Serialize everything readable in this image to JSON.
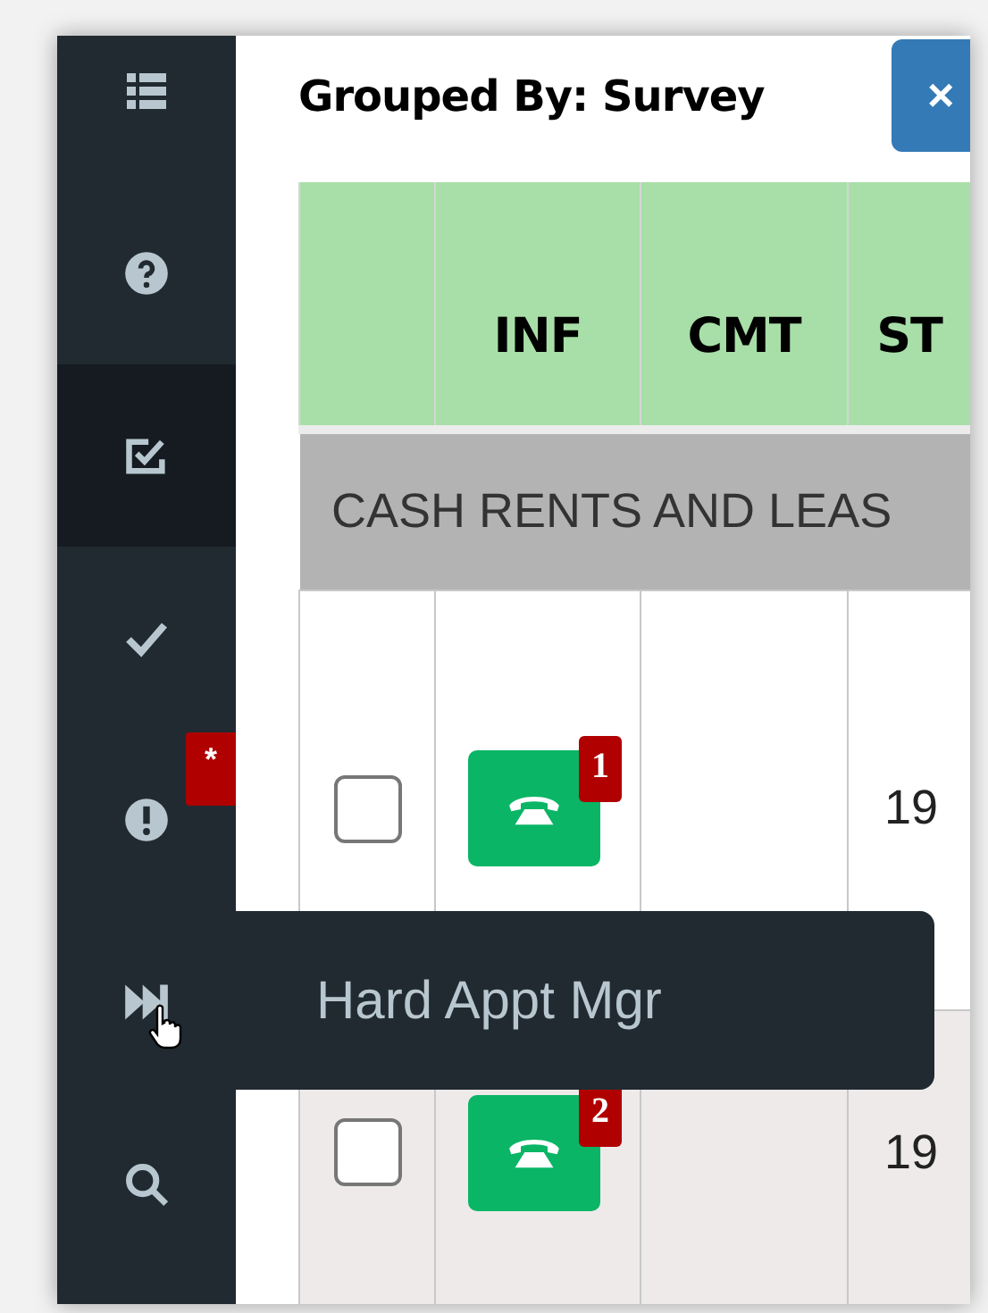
{
  "sidebar": {
    "items": [
      {
        "selected": false
      },
      {
        "selected": false
      },
      {
        "selected": true
      },
      {
        "selected": false
      },
      {
        "selected": false,
        "badge": "*"
      },
      {
        "selected": false,
        "tooltip": "Hard Appt Mgr"
      },
      {
        "selected": false
      }
    ]
  },
  "title": "Grouped By: Survey",
  "close_button": "×",
  "table": {
    "columns": [
      "",
      "INF",
      "CMT",
      "ST"
    ],
    "group": "CASH RENTS AND LEAS",
    "rows": [
      {
        "checked": false,
        "badge": "1",
        "cmt": "",
        "st": "19"
      },
      {
        "checked": false,
        "badge": "2",
        "cmt": "",
        "st": "19"
      }
    ]
  }
}
